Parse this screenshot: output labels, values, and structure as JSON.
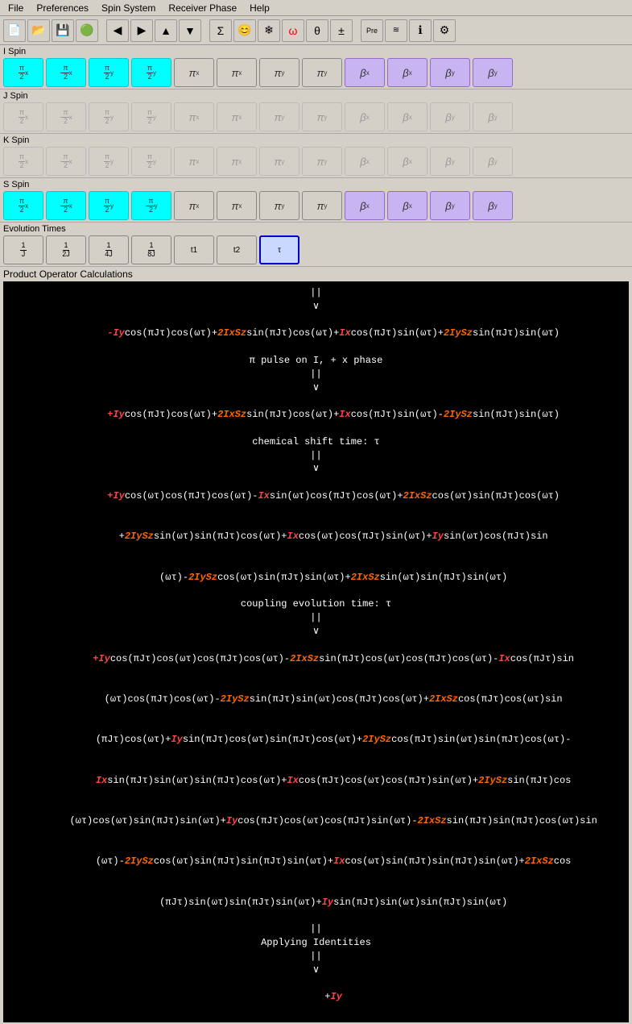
{
  "menubar": {
    "items": [
      "File",
      "Preferences",
      "Spin System",
      "Receiver Phase",
      "Help"
    ]
  },
  "toolbar": {
    "buttons": [
      "new",
      "open",
      "save",
      "green-circle",
      "arrow-left",
      "arrow-right",
      "arrow-up",
      "arrow-down",
      "sigma",
      "smiley",
      "snowflake",
      "omega-red",
      "theta",
      "plusminus",
      "pre",
      "wave",
      "info",
      "settings"
    ]
  },
  "spins": {
    "i_spin": {
      "label": "I Spin",
      "buttons": [
        {
          "label": "π/2 x",
          "state": "cyan"
        },
        {
          "label": "-π/2 x",
          "state": "cyan"
        },
        {
          "label": "π/2 y",
          "state": "cyan"
        },
        {
          "label": "π/2 y",
          "state": "cyan"
        },
        {
          "label": "πx",
          "state": "normal"
        },
        {
          "label": "πx",
          "state": "normal"
        },
        {
          "label": "πy",
          "state": "normal"
        },
        {
          "label": "πy",
          "state": "normal"
        },
        {
          "label": "βx",
          "state": "purple"
        },
        {
          "label": "βx",
          "state": "purple"
        },
        {
          "label": "βy",
          "state": "purple"
        },
        {
          "label": "βy",
          "state": "purple"
        }
      ]
    },
    "j_spin": {
      "label": "J Spin",
      "buttons": [
        {
          "label": "π/2 x",
          "state": "disabled"
        },
        {
          "label": "-π/2 x",
          "state": "disabled"
        },
        {
          "label": "π/2 y",
          "state": "disabled"
        },
        {
          "label": "π/2 y",
          "state": "disabled"
        },
        {
          "label": "πx",
          "state": "disabled"
        },
        {
          "label": "πx",
          "state": "disabled"
        },
        {
          "label": "πy",
          "state": "disabled"
        },
        {
          "label": "πy",
          "state": "disabled"
        },
        {
          "label": "βx",
          "state": "disabled"
        },
        {
          "label": "βx",
          "state": "disabled"
        },
        {
          "label": "βy",
          "state": "disabled"
        },
        {
          "label": "βy",
          "state": "disabled"
        }
      ]
    },
    "k_spin": {
      "label": "K Spin",
      "buttons": [
        {
          "label": "π/2 x",
          "state": "disabled"
        },
        {
          "label": "-π/2 x",
          "state": "disabled"
        },
        {
          "label": "π/2 y",
          "state": "disabled"
        },
        {
          "label": "π/2 y",
          "state": "disabled"
        },
        {
          "label": "πx",
          "state": "disabled"
        },
        {
          "label": "πx",
          "state": "disabled"
        },
        {
          "label": "πy",
          "state": "disabled"
        },
        {
          "label": "πy",
          "state": "disabled"
        },
        {
          "label": "βx",
          "state": "disabled"
        },
        {
          "label": "βx",
          "state": "disabled"
        },
        {
          "label": "βy",
          "state": "disabled"
        },
        {
          "label": "βy",
          "state": "disabled"
        }
      ]
    },
    "s_spin": {
      "label": "S Spin",
      "buttons": [
        {
          "label": "π/2 x",
          "state": "cyan"
        },
        {
          "label": "-π/2 x",
          "state": "cyan"
        },
        {
          "label": "π/2 y",
          "state": "cyan"
        },
        {
          "label": "-π/2 y",
          "state": "cyan"
        },
        {
          "label": "πx",
          "state": "normal"
        },
        {
          "label": "πx",
          "state": "normal"
        },
        {
          "label": "πy",
          "state": "normal"
        },
        {
          "label": "πy",
          "state": "normal"
        },
        {
          "label": "βx",
          "state": "purple"
        },
        {
          "label": "βx",
          "state": "purple"
        },
        {
          "label": "βy",
          "state": "purple"
        },
        {
          "label": "βy",
          "state": "purple"
        }
      ]
    }
  },
  "evolution": {
    "label": "Evolution Times",
    "buttons": [
      {
        "label": "1/J",
        "state": "normal"
      },
      {
        "label": "1/2J",
        "state": "normal"
      },
      {
        "label": "1/4J",
        "state": "normal"
      },
      {
        "label": "1/8J",
        "state": "normal"
      },
      {
        "label": "t1",
        "state": "normal"
      },
      {
        "label": "t2",
        "state": "normal"
      },
      {
        "label": "τ",
        "state": "active"
      }
    ]
  },
  "product_operator": {
    "label": "Product Operator Calculations",
    "lines": [
      "||",
      "∨",
      "-Iy cos(πJτ)cos(ωτ)+2IxSz sin(πJτ)cos(ωτ)+Ix cos(πJτ)sin(ωτ)+2IySz sin(πJτ)sin(ωτ)",
      "π pulse on I, + x phase",
      "||",
      "∨",
      "+Iy cos(πJτ)cos(ωτ)+2IxSz sin(πJτ)cos(ωτ)+Ix cos(πJτ)sin(ωτ)-2IySz sin(πJτ)sin(ωτ)",
      "chemical shift time: τ",
      "||",
      "∨",
      "+Iy cos(ωτ)cos(πJτ)cos(ωτ)-Ix sin(ωτ)cos(πJτ)cos(ωτ)+2IxSz cos(ωτ)sin(πJτ)cos(ωτ)",
      "+2IySz sin(ωτ)sin(πJτ)cos(ωτ)+Ix cos(ωτ)cos(πJτ)sin(ωτ)+Iy sin(ωτ)cos(πJτ)sin",
      "(ωτ)-2IySz cos(ωτ)sin(πJτ)sin(ωτ)+2IxSz sin(ωτ)sin(πJτ)sin(ωτ)",
      "coupling evolution time: τ",
      "||",
      "∨",
      "+Iy cos(πJτ)cos(ωτ)cos(πJτ)cos(ωτ)-2IxSz sin(πJτ)cos(ωτ)cos(πJτ)cos(ωτ)-Ix cos(πJτ)sin",
      "(ωτ)cos(πJτ)cos(ωτ)-2IySz sin(πJτ)sin(ωτ)cos(πJτ)cos(ωτ)+2IxSz cos(πJτ)cos(ωτ)sin",
      "(πJτ)cos(ωτ)+Iy sin(πJτ)cos(ωτ)sin(πJτ)cos(ωτ)+2IySz cos(πJτ)sin(ωτ)sin(πJτ)cos(ωτ)-",
      "Ix sin(πJτ)sin(ωτ)sin(πJτ)cos(ωτ)+Ix cos(πJτ)cos(ωτ)cos(πJτ)sin(ωτ)+2IySz sin(πJτ)cos",
      "(ωτ)cos(ωτ)sin(πJτ)sin(ωτ)+Iy cos(πJτ)cos(ωτ)cos(πJτ)sin(ωτ)-2IxSz sin(πJτ)sin(πJτ)cos(ωτ)sin",
      "(ωτ)-2IySz cos(ωτ)sin(πJτ)sin(πJτ)sin(ωτ)+Ix cos(ωτ)sin(πJτ)sin(πJτ)sin(ωτ)+2IxSz cos",
      "(πJτ)sin(ωτ)sin(πJτ)sin(ωτ)+Iy sin(πJτ)sin(ωτ)sin(πJτ)sin(ωτ)",
      "||",
      "Applying Identities",
      "||",
      "∨",
      "+Iy"
    ]
  }
}
